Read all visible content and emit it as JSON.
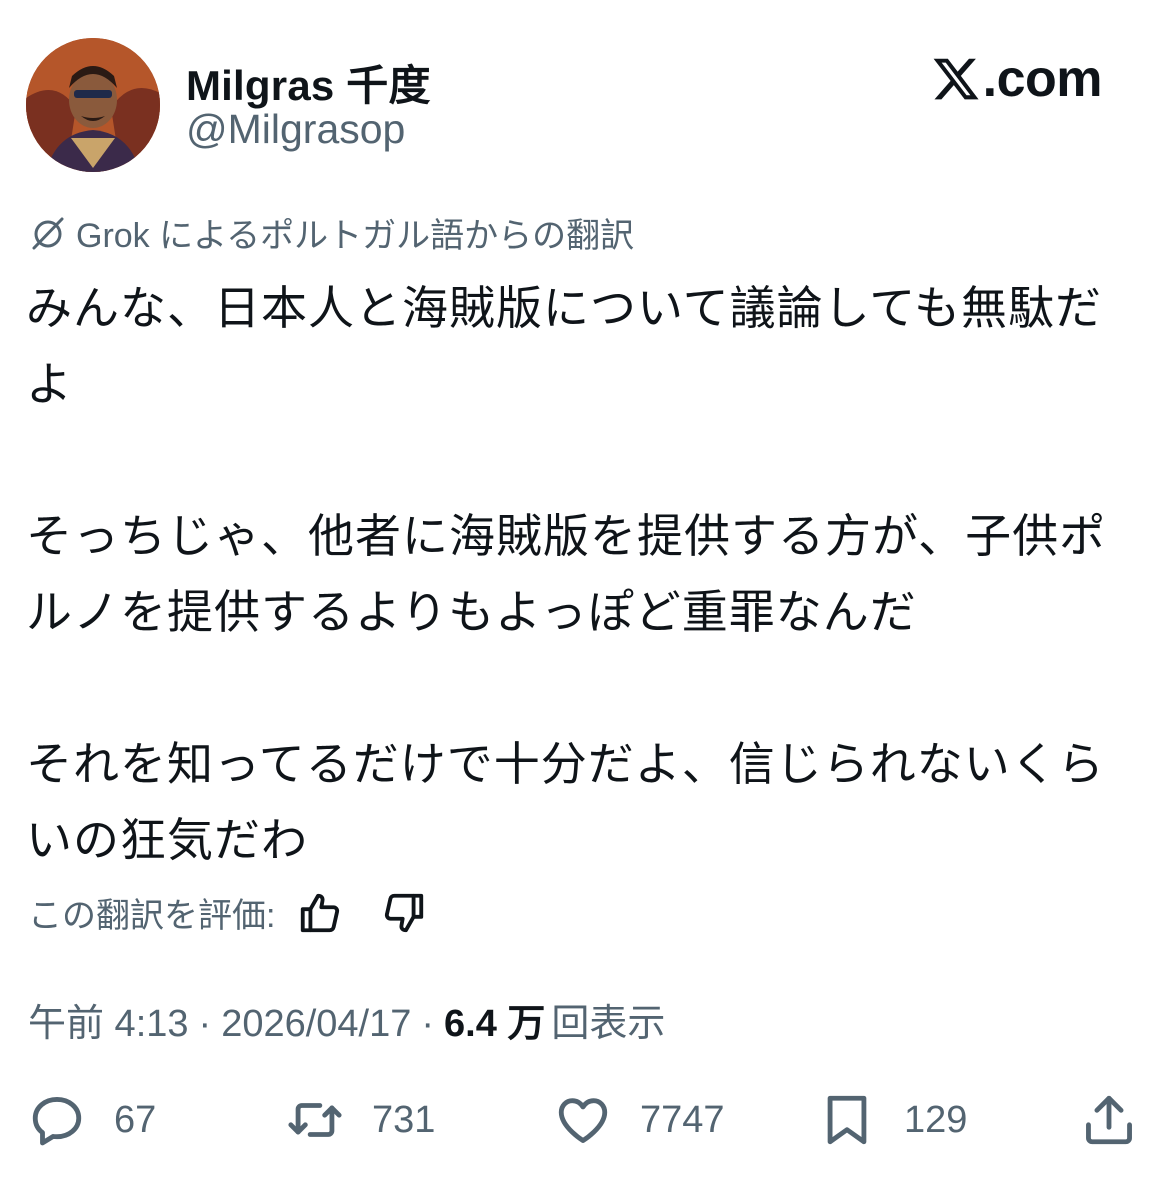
{
  "author": {
    "display_name": "Milgras 千度",
    "handle": "@Milgrasop",
    "avatar_icon": "avatar"
  },
  "brand": {
    "logo_icon": "x-logo-icon",
    "suffix": ".com"
  },
  "translation": {
    "icon": "grok-icon",
    "label": "Grok によるポルトガル語からの翻訳"
  },
  "tweet": {
    "paragraphs": [
      "みんな、日本人と海賊版について議論しても無駄だよ",
      "そっちじゃ、他者に海賊版を提供する方が、子供ポルノを提供するよりもよっぽど重罪なんだ",
      "それを知ってるだけで十分だよ、信じられないくらいの狂気だわ"
    ]
  },
  "rating": {
    "label": "この翻訳を評価:",
    "up_icon": "thumbs-up-icon",
    "down_icon": "thumbs-down-icon"
  },
  "meta": {
    "time": "午前 4:13",
    "date": "2026/04/17",
    "separator": "·",
    "views_count": "6.4 万",
    "views_label": "回表示"
  },
  "actions": {
    "replies": "67",
    "reposts": "731",
    "likes": "7747",
    "bookmarks": "129"
  },
  "colors": {
    "text": "#0f1419",
    "secondary": "#536471",
    "background": "#ffffff"
  }
}
